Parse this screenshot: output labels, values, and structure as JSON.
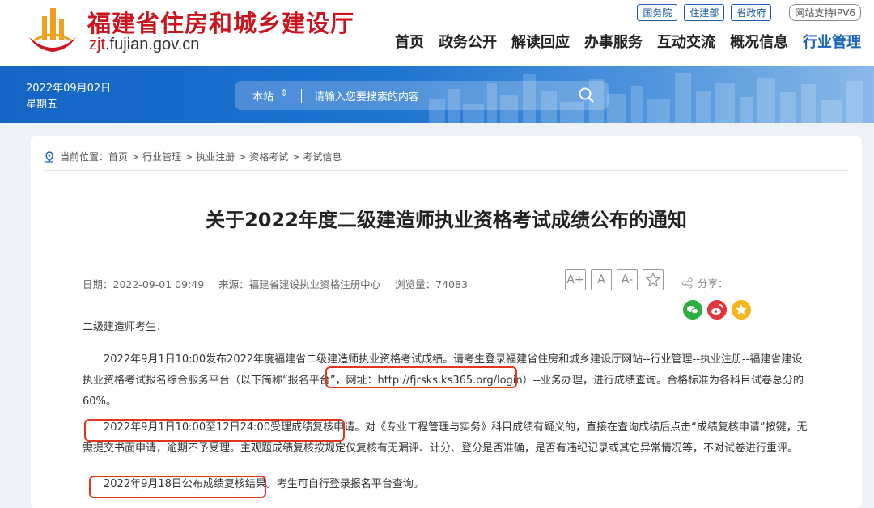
{
  "header": {
    "site_title": "福建省住房和城乡建设厅",
    "site_domain_prefix": "zjt",
    "site_domain_suffix": ".fujian.gov.cn",
    "top_links": [
      "国务院",
      "住建部",
      "省政府"
    ],
    "ipv6_label": "网站支持IPV6",
    "nav": [
      "首页",
      "政务公开",
      "解读回应",
      "办事服务",
      "互动交流",
      "概况信息",
      "行业管理"
    ],
    "active_nav": "行业管理"
  },
  "banner": {
    "date": "2022年09月02日",
    "weekday": "星期五",
    "search_scope": "本站",
    "search_placeholder": "请输入您要搜索的内容"
  },
  "breadcrumb": {
    "prefix": "当前位置：",
    "items": [
      "首页",
      "行业管理",
      "执业注册",
      "资格考试",
      "考试信息"
    ]
  },
  "article": {
    "title": "关于2022年度二级建造师执业资格考试成绩公布的通知",
    "date": "日期：2022-09-01 09:49",
    "source": "来源：福建省建设执业资格注册中心",
    "views": "浏览量：74083",
    "font_buttons": [
      "A+",
      "A",
      "A-"
    ],
    "share_label": "分享：",
    "greeting": "二级建造师考生：",
    "para1": "2022年9月1日10:00发布2022年度福建省二级建造师执业资格考试成绩。请考生登录福建省住房和城乡建设厅网站--行业管理--执业注册--福建省建设执业资格考试报名综合服务平台（以下简称“报名平台”，网址：http://fjrsks.ks365.org/login）--业务办理，进行成绩查询。合格标准为各科目试卷总分的60%。",
    "para2": "2022年9月1日10:00至12日24:00受理成绩复核申请。对《专业工程管理与实务》科目成绩有疑义的，直接在查询成绩后点击“成绩复核申请”按键，无需提交书面申请，逾期不予受理。主观题成绩复核按规定仅复核有无漏评、计分、登分是否准确，是否有违纪记录或其它异常情况等，不对试卷进行重评。",
    "para3": "2022年9月18日公布成绩复核结果。考生可自行登录报名平台查询。"
  },
  "colors": {
    "brand_red": "#c9151e",
    "nav_active": "#1a63b8",
    "banner_blue": "#1464c4",
    "highlight_box": "#e1371e"
  }
}
